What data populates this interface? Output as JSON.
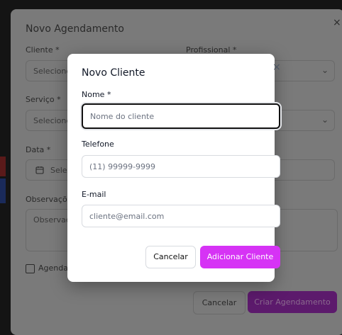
{
  "background_form": {
    "title": "Novo Agendamento",
    "close": "×",
    "cliente_label": "Cliente *",
    "cliente_placeholder": "Selecione",
    "profissional_label": "Profissional *",
    "servico_label": "Serviço *",
    "servico_placeholder": "Selecione",
    "data_label": "Data *",
    "data_value": "Sele",
    "observacoes_label": "Observaçõ",
    "observacoes_placeholder": "Observaçõ",
    "checkbox_label": "Agenda",
    "cancel_label": "Cancelar",
    "create_label": "Criar Agendamento"
  },
  "modal": {
    "title": "Novo Cliente",
    "close": "×",
    "nome_label": "Nome *",
    "nome_placeholder": "Nome do cliente",
    "telefone_label": "Telefone",
    "telefone_placeholder": "(11) 99999-9999",
    "email_label": "E-mail",
    "email_placeholder": "cliente@email.com",
    "cancel_label": "Cancelar",
    "submit_label": "Adicionar Cliente"
  },
  "colors": {
    "accent": "#d633f5",
    "accent_dimmed": "#5c1a6c",
    "overlay": "#141414",
    "left_strip_red": "#5a1a1a",
    "left_strip_blue": "#1a2a5a"
  }
}
